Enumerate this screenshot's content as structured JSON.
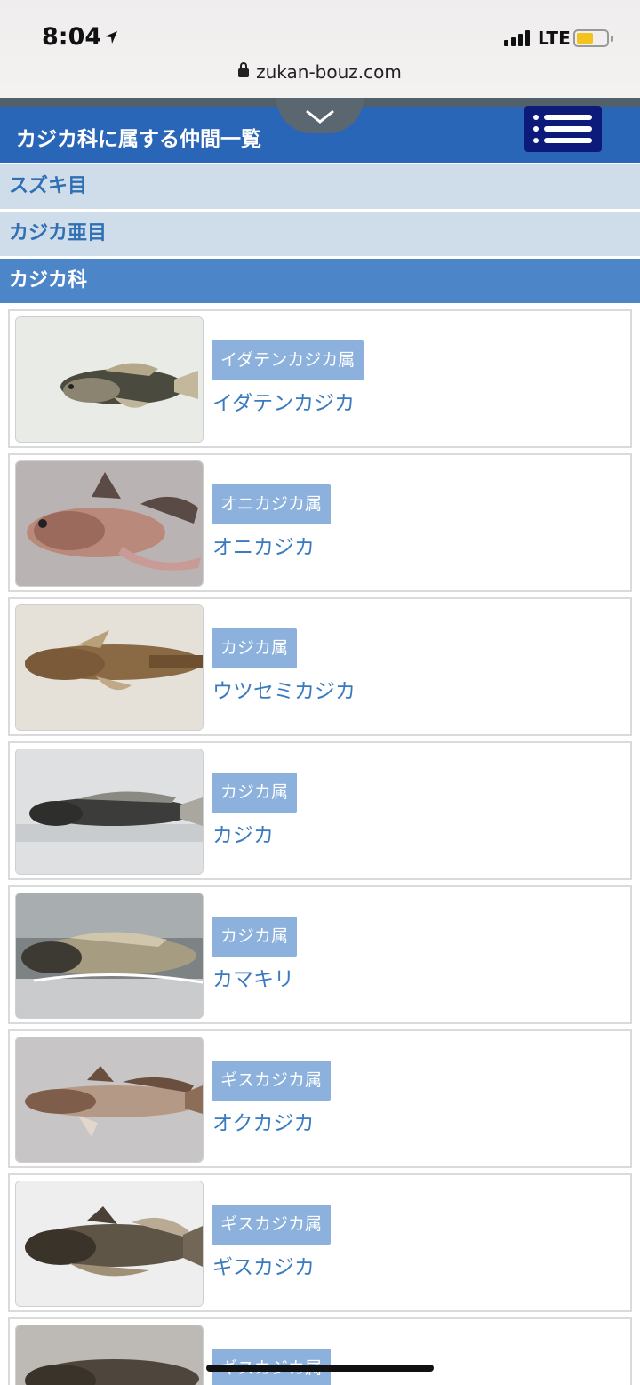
{
  "status_bar": {
    "time": "8:04",
    "network": "LTE"
  },
  "browser": {
    "url": "zukan-bouz.com"
  },
  "header": {
    "title": "カジカ科に属する仲間一覧"
  },
  "breadcrumbs": [
    {
      "label": "スズキ目"
    },
    {
      "label": "カジカ亜目"
    },
    {
      "label": "カジカ科"
    }
  ],
  "items": [
    {
      "genus": "イダテンカジカ属",
      "name": "イダテンカジカ"
    },
    {
      "genus": "オニカジカ属",
      "name": "オニカジカ"
    },
    {
      "genus": "カジカ属",
      "name": "ウツセミカジカ"
    },
    {
      "genus": "カジカ属",
      "name": "カジカ"
    },
    {
      "genus": "カジカ属",
      "name": "カマキリ"
    },
    {
      "genus": "ギスカジカ属",
      "name": "オクカジカ"
    },
    {
      "genus": "ギスカジカ属",
      "name": "ギスカジカ"
    },
    {
      "genus": "ギスカジカ属",
      "name": ""
    }
  ],
  "colors": {
    "header": "#2a66b8",
    "menu_button": "#0c1b7a",
    "breadcrumb_bg": "#cfdcea",
    "breadcrumb_active": "#4d86c8",
    "genus_badge": "#8cb1dc",
    "species_link": "#3a7bbf"
  }
}
